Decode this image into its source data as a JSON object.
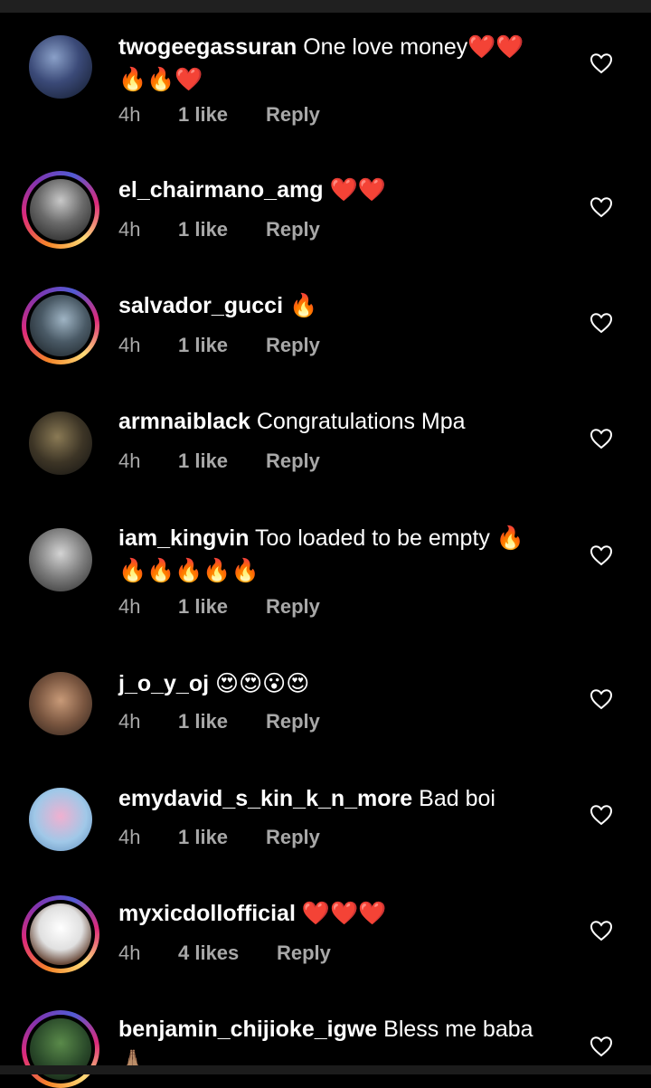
{
  "colors": {
    "background": "#000000",
    "meta_text": "#a8a8a8",
    "story_ring": "#dd2a7b"
  },
  "comments": [
    {
      "username": "twogeegassuran",
      "text": "One love money",
      "emoji_line1": "❤️❤️",
      "emoji_line2": "🔥🔥❤️",
      "time": "4h",
      "likes": "1 like",
      "reply": "Reply",
      "story_ring": false
    },
    {
      "username": "el_chairmano_amg",
      "text": "",
      "emoji_line1": "❤️❤️",
      "time": "4h",
      "likes": "1 like",
      "reply": "Reply",
      "story_ring": true
    },
    {
      "username": "salvador_gucci",
      "text": "",
      "emoji_line1": "🔥",
      "time": "4h",
      "likes": "1 like",
      "reply": "Reply",
      "story_ring": true
    },
    {
      "username": "armnaiblack",
      "text": "Congratulations Mpa",
      "emoji_line1": "",
      "time": "4h",
      "likes": "1 like",
      "reply": "Reply",
      "story_ring": false
    },
    {
      "username": "iam_kingvin",
      "text": "Too loaded to be empty",
      "emoji_line1": "🔥",
      "emoji_line2": "🔥🔥🔥🔥🔥",
      "time": "4h",
      "likes": "1 like",
      "reply": "Reply",
      "story_ring": false
    },
    {
      "username": "j_o_y_oj",
      "text": "",
      "emoji_line1": "😍😍😮😍",
      "time": "4h",
      "likes": "1 like",
      "reply": "Reply",
      "story_ring": false
    },
    {
      "username": "emydavid_s_kin_k_n_more",
      "text": "Bad boi",
      "emoji_line1": "",
      "time": "4h",
      "likes": "1 like",
      "reply": "Reply",
      "story_ring": false
    },
    {
      "username": "myxicdollofficial",
      "text": "",
      "emoji_line1": "❤️❤️❤️",
      "time": "4h",
      "likes": "4 likes",
      "reply": "Reply",
      "story_ring": true
    },
    {
      "username": "benjamin_chijioke_igwe",
      "text": "Bless me baba",
      "emoji_line2": "🙏🏽",
      "story_ring": true
    }
  ],
  "icons": {
    "like": "heart-outline-icon"
  }
}
